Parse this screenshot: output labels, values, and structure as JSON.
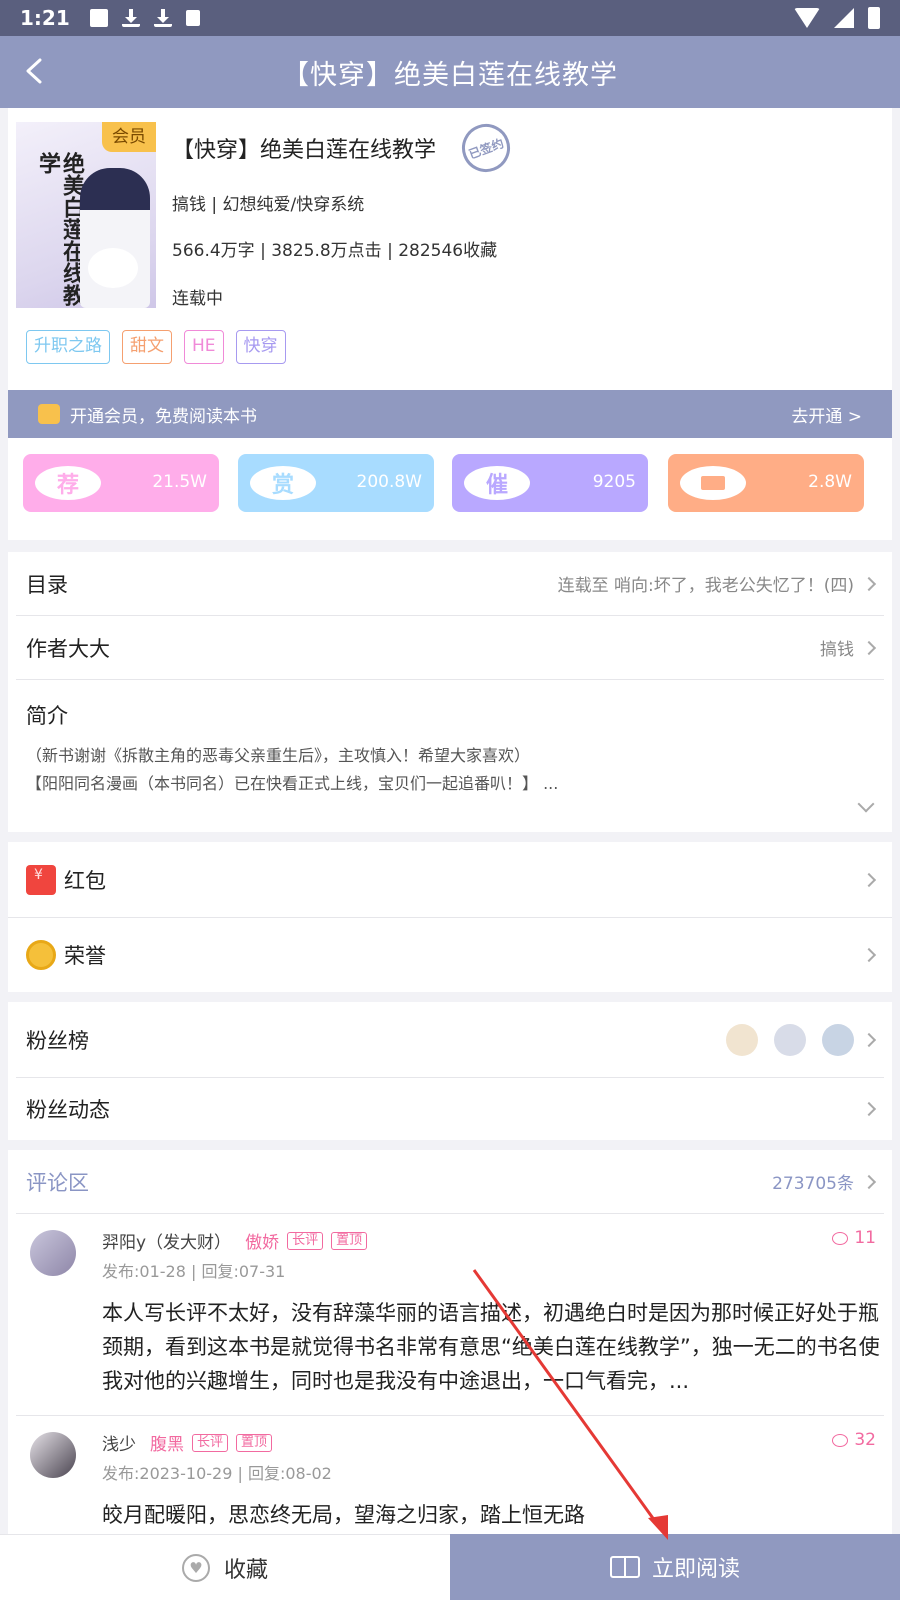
{
  "status_bar": {
    "time": "1:21"
  },
  "nav": {
    "title": "【快穿】绝美白莲在线教学"
  },
  "book": {
    "vip_badge": "会员",
    "title": "【快穿】绝美白莲在线教学",
    "signed_stamp": "已签约",
    "author_genre": "搞钱 | 幻想纯爱/快穿系统",
    "stats_line": "566.4万字 | 3825.8万点击 | 282546收藏",
    "status": "连载中",
    "cover_title": "绝美白莲在线教学",
    "tags": [
      {
        "label": "升职之路",
        "color": "#7ec8f0"
      },
      {
        "label": "甜文",
        "color": "#f5a070"
      },
      {
        "label": "HE",
        "color": "#f08ad8"
      },
      {
        "label": "快穿",
        "color": "#a79af0"
      }
    ]
  },
  "vip_bar": {
    "text": "开通会员，免费阅读本书",
    "action": "去开通 >"
  },
  "stats": [
    {
      "icon_char": "荐",
      "value": "21.5W",
      "color": "#ffadea"
    },
    {
      "icon_char": "赏",
      "value": "200.8W",
      "color": "#a8dcff"
    },
    {
      "icon_char": "催",
      "value": "9205",
      "color": "#b9a8ff"
    },
    {
      "icon_char": "",
      "value": "2.8W",
      "color": "#ffad86"
    }
  ],
  "info": {
    "catalog_label": "目录",
    "catalog_value": "连载至 哨向:坏了，我老公失忆了！(四)",
    "author_label": "作者大大",
    "author_value": "搞钱",
    "intro_label": "简介",
    "intro_lines": [
      "（新书谢谢《拆散主角的恶毒父亲重生后》，主攻慎入！希望大家喜欢）",
      "【阳阳同名漫画（本书同名）已在快看正式上线，宝贝们一起追番叭！】 ..."
    ]
  },
  "rewards": {
    "redpack_label": "红包",
    "honor_label": "荣誉"
  },
  "fans": {
    "rank_label": "粉丝榜",
    "activity_label": "粉丝动态"
  },
  "comments": {
    "label": "评论区",
    "count": "273705条",
    "items": [
      {
        "name": "羿阳y（发大财）",
        "trait": "傲娇",
        "badges": [
          "长评",
          "置顶"
        ],
        "meta": "发布:01-28 | 回复:07-31",
        "replies": "11",
        "text": "本人写长评不太好，没有辞藻华丽的语言描述，初遇绝白时是因为那时候正好处于瓶颈期，看到这本书是就觉得书名非常有意思“绝美白莲在线教学”，独一无二的书名使我对他的兴趣增生，同时也是我没有中途退出，一口气看完，..."
      },
      {
        "name": "浅少",
        "trait": "腹黑",
        "badges": [
          "长评",
          "置顶"
        ],
        "meta": "发布:2023-10-29 | 回复:08-02",
        "replies": "32",
        "text": "皎月配暖阳，思恋终无局，望海之归家，踏上恒无路"
      }
    ]
  },
  "bottom": {
    "favorite_label": "收藏",
    "read_label": "立即阅读"
  }
}
